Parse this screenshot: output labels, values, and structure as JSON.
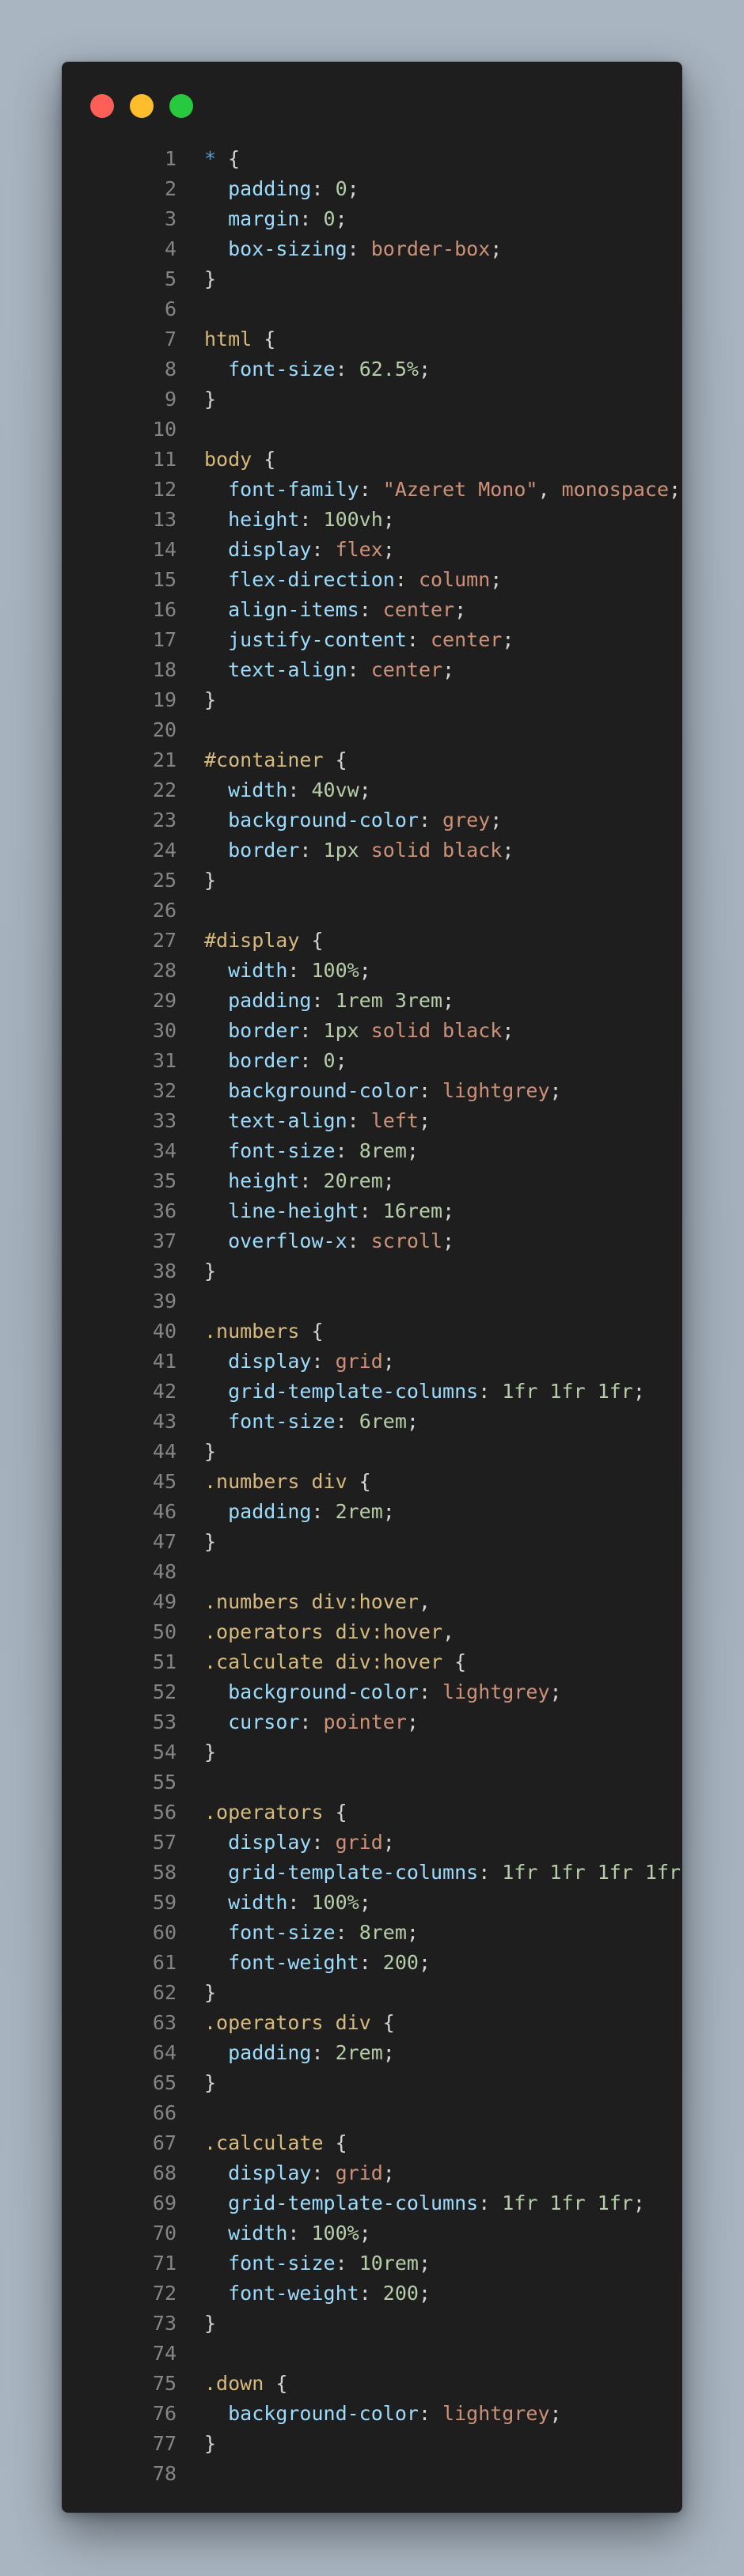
{
  "window": {
    "controls": [
      {
        "name": "close-dot",
        "color": "#ff5f56"
      },
      {
        "name": "minimize-dot",
        "color": "#ffbd2e"
      },
      {
        "name": "maximize-dot",
        "color": "#27c93f"
      }
    ]
  },
  "colors": {
    "selector": "#d7ba7d",
    "universal": "#569cd6",
    "property": "#9cdcfe",
    "value": "#ce9178",
    "number": "#b5cea8",
    "punctuation": "#d4d4d4",
    "line_number": "#858585"
  },
  "code": {
    "lines": [
      [
        [
          "star",
          "*"
        ],
        [
          "punc",
          " {"
        ]
      ],
      [
        [
          "punc",
          "  "
        ],
        [
          "prop",
          "padding"
        ],
        [
          "punc",
          ": "
        ],
        [
          "num",
          "0"
        ],
        [
          "punc",
          ";"
        ]
      ],
      [
        [
          "punc",
          "  "
        ],
        [
          "prop",
          "margin"
        ],
        [
          "punc",
          ": "
        ],
        [
          "num",
          "0"
        ],
        [
          "punc",
          ";"
        ]
      ],
      [
        [
          "punc",
          "  "
        ],
        [
          "prop",
          "box-sizing"
        ],
        [
          "punc",
          ": "
        ],
        [
          "val",
          "border-box"
        ],
        [
          "punc",
          ";"
        ]
      ],
      [
        [
          "punc",
          "}"
        ]
      ],
      [],
      [
        [
          "sel",
          "html"
        ],
        [
          "punc",
          " {"
        ]
      ],
      [
        [
          "punc",
          "  "
        ],
        [
          "prop",
          "font-size"
        ],
        [
          "punc",
          ": "
        ],
        [
          "num",
          "62.5%"
        ],
        [
          "punc",
          ";"
        ]
      ],
      [
        [
          "punc",
          "}"
        ]
      ],
      [],
      [
        [
          "sel",
          "body"
        ],
        [
          "punc",
          " {"
        ]
      ],
      [
        [
          "punc",
          "  "
        ],
        [
          "prop",
          "font-family"
        ],
        [
          "punc",
          ": "
        ],
        [
          "val",
          "\"Azeret Mono\""
        ],
        [
          "punc",
          ", "
        ],
        [
          "val",
          "monospace"
        ],
        [
          "punc",
          ";"
        ]
      ],
      [
        [
          "punc",
          "  "
        ],
        [
          "prop",
          "height"
        ],
        [
          "punc",
          ": "
        ],
        [
          "num",
          "100vh"
        ],
        [
          "punc",
          ";"
        ]
      ],
      [
        [
          "punc",
          "  "
        ],
        [
          "prop",
          "display"
        ],
        [
          "punc",
          ": "
        ],
        [
          "val",
          "flex"
        ],
        [
          "punc",
          ";"
        ]
      ],
      [
        [
          "punc",
          "  "
        ],
        [
          "prop",
          "flex-direction"
        ],
        [
          "punc",
          ": "
        ],
        [
          "val",
          "column"
        ],
        [
          "punc",
          ";"
        ]
      ],
      [
        [
          "punc",
          "  "
        ],
        [
          "prop",
          "align-items"
        ],
        [
          "punc",
          ": "
        ],
        [
          "val",
          "center"
        ],
        [
          "punc",
          ";"
        ]
      ],
      [
        [
          "punc",
          "  "
        ],
        [
          "prop",
          "justify-content"
        ],
        [
          "punc",
          ": "
        ],
        [
          "val",
          "center"
        ],
        [
          "punc",
          ";"
        ]
      ],
      [
        [
          "punc",
          "  "
        ],
        [
          "prop",
          "text-align"
        ],
        [
          "punc",
          ": "
        ],
        [
          "val",
          "center"
        ],
        [
          "punc",
          ";"
        ]
      ],
      [
        [
          "punc",
          "}"
        ]
      ],
      [],
      [
        [
          "sel",
          "#container"
        ],
        [
          "punc",
          " {"
        ]
      ],
      [
        [
          "punc",
          "  "
        ],
        [
          "prop",
          "width"
        ],
        [
          "punc",
          ": "
        ],
        [
          "num",
          "40vw"
        ],
        [
          "punc",
          ";"
        ]
      ],
      [
        [
          "punc",
          "  "
        ],
        [
          "prop",
          "background-color"
        ],
        [
          "punc",
          ": "
        ],
        [
          "val",
          "grey"
        ],
        [
          "punc",
          ";"
        ]
      ],
      [
        [
          "punc",
          "  "
        ],
        [
          "prop",
          "border"
        ],
        [
          "punc",
          ": "
        ],
        [
          "num",
          "1px"
        ],
        [
          "punc",
          " "
        ],
        [
          "val",
          "solid black"
        ],
        [
          "punc",
          ";"
        ]
      ],
      [
        [
          "punc",
          "}"
        ]
      ],
      [],
      [
        [
          "sel",
          "#display"
        ],
        [
          "punc",
          " {"
        ]
      ],
      [
        [
          "punc",
          "  "
        ],
        [
          "prop",
          "width"
        ],
        [
          "punc",
          ": "
        ],
        [
          "num",
          "100%"
        ],
        [
          "punc",
          ";"
        ]
      ],
      [
        [
          "punc",
          "  "
        ],
        [
          "prop",
          "padding"
        ],
        [
          "punc",
          ": "
        ],
        [
          "num",
          "1rem 3rem"
        ],
        [
          "punc",
          ";"
        ]
      ],
      [
        [
          "punc",
          "  "
        ],
        [
          "prop",
          "border"
        ],
        [
          "punc",
          ": "
        ],
        [
          "num",
          "1px"
        ],
        [
          "punc",
          " "
        ],
        [
          "val",
          "solid black"
        ],
        [
          "punc",
          ";"
        ]
      ],
      [
        [
          "punc",
          "  "
        ],
        [
          "prop",
          "border"
        ],
        [
          "punc",
          ": "
        ],
        [
          "num",
          "0"
        ],
        [
          "punc",
          ";"
        ]
      ],
      [
        [
          "punc",
          "  "
        ],
        [
          "prop",
          "background-color"
        ],
        [
          "punc",
          ": "
        ],
        [
          "val",
          "lightgrey"
        ],
        [
          "punc",
          ";"
        ]
      ],
      [
        [
          "punc",
          "  "
        ],
        [
          "prop",
          "text-align"
        ],
        [
          "punc",
          ": "
        ],
        [
          "val",
          "left"
        ],
        [
          "punc",
          ";"
        ]
      ],
      [
        [
          "punc",
          "  "
        ],
        [
          "prop",
          "font-size"
        ],
        [
          "punc",
          ": "
        ],
        [
          "num",
          "8rem"
        ],
        [
          "punc",
          ";"
        ]
      ],
      [
        [
          "punc",
          "  "
        ],
        [
          "prop",
          "height"
        ],
        [
          "punc",
          ": "
        ],
        [
          "num",
          "20rem"
        ],
        [
          "punc",
          ";"
        ]
      ],
      [
        [
          "punc",
          "  "
        ],
        [
          "prop",
          "line-height"
        ],
        [
          "punc",
          ": "
        ],
        [
          "num",
          "16rem"
        ],
        [
          "punc",
          ";"
        ]
      ],
      [
        [
          "punc",
          "  "
        ],
        [
          "prop",
          "overflow-x"
        ],
        [
          "punc",
          ": "
        ],
        [
          "val",
          "scroll"
        ],
        [
          "punc",
          ";"
        ]
      ],
      [
        [
          "punc",
          "}"
        ]
      ],
      [],
      [
        [
          "sel",
          ".numbers"
        ],
        [
          "punc",
          " {"
        ]
      ],
      [
        [
          "punc",
          "  "
        ],
        [
          "prop",
          "display"
        ],
        [
          "punc",
          ": "
        ],
        [
          "val",
          "grid"
        ],
        [
          "punc",
          ";"
        ]
      ],
      [
        [
          "punc",
          "  "
        ],
        [
          "prop",
          "grid-template-columns"
        ],
        [
          "punc",
          ": "
        ],
        [
          "num",
          "1fr 1fr 1fr"
        ],
        [
          "punc",
          ";"
        ]
      ],
      [
        [
          "punc",
          "  "
        ],
        [
          "prop",
          "font-size"
        ],
        [
          "punc",
          ": "
        ],
        [
          "num",
          "6rem"
        ],
        [
          "punc",
          ";"
        ]
      ],
      [
        [
          "punc",
          "}"
        ]
      ],
      [
        [
          "sel",
          ".numbers div"
        ],
        [
          "punc",
          " {"
        ]
      ],
      [
        [
          "punc",
          "  "
        ],
        [
          "prop",
          "padding"
        ],
        [
          "punc",
          ": "
        ],
        [
          "num",
          "2rem"
        ],
        [
          "punc",
          ";"
        ]
      ],
      [
        [
          "punc",
          "}"
        ]
      ],
      [],
      [
        [
          "sel",
          ".numbers div:hover"
        ],
        [
          "punc",
          ","
        ]
      ],
      [
        [
          "sel",
          ".operators div:hover"
        ],
        [
          "punc",
          ","
        ]
      ],
      [
        [
          "sel",
          ".calculate div:hover"
        ],
        [
          "punc",
          " {"
        ]
      ],
      [
        [
          "punc",
          "  "
        ],
        [
          "prop",
          "background-color"
        ],
        [
          "punc",
          ": "
        ],
        [
          "val",
          "lightgrey"
        ],
        [
          "punc",
          ";"
        ]
      ],
      [
        [
          "punc",
          "  "
        ],
        [
          "prop",
          "cursor"
        ],
        [
          "punc",
          ": "
        ],
        [
          "val",
          "pointer"
        ],
        [
          "punc",
          ";"
        ]
      ],
      [
        [
          "punc",
          "}"
        ]
      ],
      [],
      [
        [
          "sel",
          ".operators"
        ],
        [
          "punc",
          " {"
        ]
      ],
      [
        [
          "punc",
          "  "
        ],
        [
          "prop",
          "display"
        ],
        [
          "punc",
          ": "
        ],
        [
          "val",
          "grid"
        ],
        [
          "punc",
          ";"
        ]
      ],
      [
        [
          "punc",
          "  "
        ],
        [
          "prop",
          "grid-template-columns"
        ],
        [
          "punc",
          ": "
        ],
        [
          "num",
          "1fr 1fr 1fr 1fr"
        ],
        [
          "punc",
          ";"
        ]
      ],
      [
        [
          "punc",
          "  "
        ],
        [
          "prop",
          "width"
        ],
        [
          "punc",
          ": "
        ],
        [
          "num",
          "100%"
        ],
        [
          "punc",
          ";"
        ]
      ],
      [
        [
          "punc",
          "  "
        ],
        [
          "prop",
          "font-size"
        ],
        [
          "punc",
          ": "
        ],
        [
          "num",
          "8rem"
        ],
        [
          "punc",
          ";"
        ]
      ],
      [
        [
          "punc",
          "  "
        ],
        [
          "prop",
          "font-weight"
        ],
        [
          "punc",
          ": "
        ],
        [
          "num",
          "200"
        ],
        [
          "punc",
          ";"
        ]
      ],
      [
        [
          "punc",
          "}"
        ]
      ],
      [
        [
          "sel",
          ".operators div"
        ],
        [
          "punc",
          " {"
        ]
      ],
      [
        [
          "punc",
          "  "
        ],
        [
          "prop",
          "padding"
        ],
        [
          "punc",
          ": "
        ],
        [
          "num",
          "2rem"
        ],
        [
          "punc",
          ";"
        ]
      ],
      [
        [
          "punc",
          "}"
        ]
      ],
      [],
      [
        [
          "sel",
          ".calculate"
        ],
        [
          "punc",
          " {"
        ]
      ],
      [
        [
          "punc",
          "  "
        ],
        [
          "prop",
          "display"
        ],
        [
          "punc",
          ": "
        ],
        [
          "val",
          "grid"
        ],
        [
          "punc",
          ";"
        ]
      ],
      [
        [
          "punc",
          "  "
        ],
        [
          "prop",
          "grid-template-columns"
        ],
        [
          "punc",
          ": "
        ],
        [
          "num",
          "1fr 1fr 1fr"
        ],
        [
          "punc",
          ";"
        ]
      ],
      [
        [
          "punc",
          "  "
        ],
        [
          "prop",
          "width"
        ],
        [
          "punc",
          ": "
        ],
        [
          "num",
          "100%"
        ],
        [
          "punc",
          ";"
        ]
      ],
      [
        [
          "punc",
          "  "
        ],
        [
          "prop",
          "font-size"
        ],
        [
          "punc",
          ": "
        ],
        [
          "num",
          "10rem"
        ],
        [
          "punc",
          ";"
        ]
      ],
      [
        [
          "punc",
          "  "
        ],
        [
          "prop",
          "font-weight"
        ],
        [
          "punc",
          ": "
        ],
        [
          "num",
          "200"
        ],
        [
          "punc",
          ";"
        ]
      ],
      [
        [
          "punc",
          "}"
        ]
      ],
      [],
      [
        [
          "sel",
          ".down"
        ],
        [
          "punc",
          " {"
        ]
      ],
      [
        [
          "punc",
          "  "
        ],
        [
          "prop",
          "background-color"
        ],
        [
          "punc",
          ": "
        ],
        [
          "val",
          "lightgrey"
        ],
        [
          "punc",
          ";"
        ]
      ],
      [
        [
          "punc",
          "}"
        ]
      ],
      []
    ]
  }
}
